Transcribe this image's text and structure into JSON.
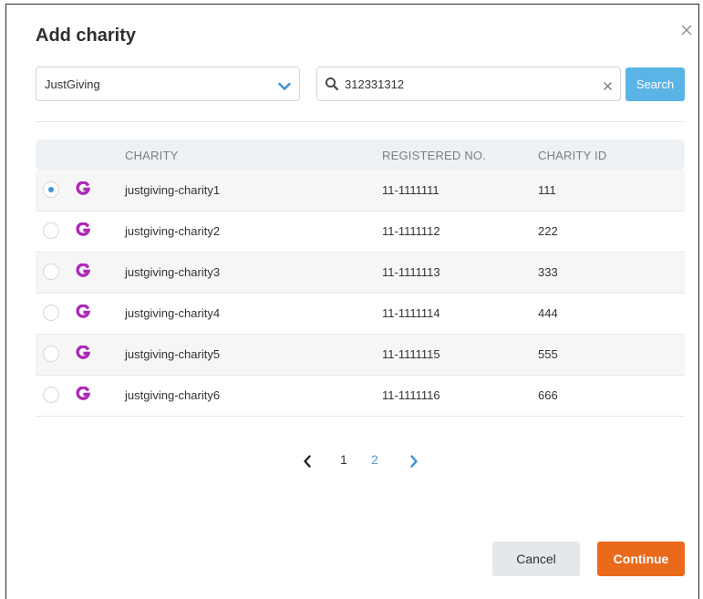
{
  "modal": {
    "title": "Add charity"
  },
  "filters": {
    "provider": "JustGiving",
    "search_value": "312331312",
    "search_button": "Search"
  },
  "table": {
    "columns": [
      "CHARITY",
      "REGISTERED NO.",
      "CHARITY ID"
    ],
    "rows": [
      {
        "name": "justgiving-charity1",
        "reg_no": "11-1111111",
        "id": "111",
        "selected": true
      },
      {
        "name": "justgiving-charity2",
        "reg_no": "11-1111112",
        "id": "222",
        "selected": false
      },
      {
        "name": "justgiving-charity3",
        "reg_no": "11-1111113",
        "id": "333",
        "selected": false
      },
      {
        "name": "justgiving-charity4",
        "reg_no": "11-1111114",
        "id": "444",
        "selected": false
      },
      {
        "name": "justgiving-charity5",
        "reg_no": "11-1111115",
        "id": "555",
        "selected": false
      },
      {
        "name": "justgiving-charity6",
        "reg_no": "11-1111116",
        "id": "666",
        "selected": false
      }
    ]
  },
  "pagination": {
    "pages": [
      "1",
      "2"
    ],
    "current": "1"
  },
  "footer": {
    "cancel_label": "Cancel",
    "continue_label": "Continue"
  },
  "colors": {
    "accent": "#5ab4e6",
    "primary": "#ea6a1c",
    "brand_logo": "#ad29b6",
    "link": "#4a9fe0"
  },
  "icons": {
    "close": "close-icon",
    "chevron": "chevron-down-icon",
    "search": "search-icon",
    "clear": "clear-icon",
    "logo": "justgiving-logo-icon"
  }
}
